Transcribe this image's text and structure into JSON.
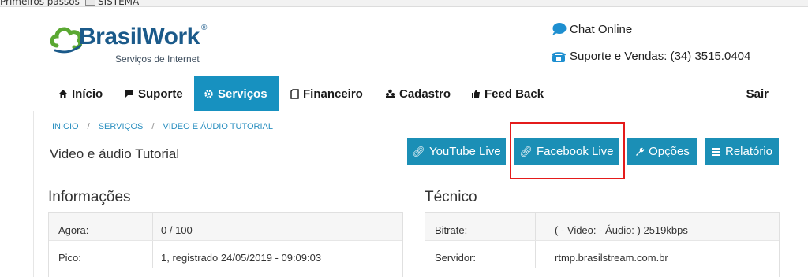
{
  "bookmarks": {
    "items": [
      {
        "label": "Primeiros passos"
      },
      {
        "label": "SISTEMA"
      }
    ]
  },
  "logo": {
    "name": "BrasilWork",
    "registered": "®",
    "tagline": "Serviços de Internet"
  },
  "contact": {
    "chat": "Chat Online",
    "phone": "Suporte e Vendas: (34) 3515.0404"
  },
  "nav": {
    "items": [
      {
        "label": "Início",
        "icon": "home-icon"
      },
      {
        "label": "Suporte",
        "icon": "comment-icon"
      },
      {
        "label": "Serviços",
        "icon": "gear-icon"
      },
      {
        "label": "Financeiro",
        "icon": "document-icon"
      },
      {
        "label": "Cadastro",
        "icon": "users-icon"
      },
      {
        "label": "Feed Back",
        "icon": "thumbs-up-icon"
      }
    ],
    "logout": "Sair"
  },
  "breadcrumb": {
    "items": [
      "INICIO",
      "SERVIÇOS",
      "VIDEO E ÁUDIO TUTORIAL"
    ],
    "separator": "/"
  },
  "page": {
    "title": "Video e áudio Tutorial"
  },
  "actions": {
    "youtube": "YouTube Live",
    "facebook": "Facebook Live",
    "opcoes": "Opções",
    "relatorio": "Relatório"
  },
  "info": {
    "title": "Informações",
    "rows": [
      {
        "key": "Agora:",
        "value": "0 / 100"
      },
      {
        "key": "Pico:",
        "value": "1, registrado 24/05/2019 - 09:09:03"
      }
    ]
  },
  "tecnico": {
    "title": "Técnico",
    "rows": [
      {
        "key": "Bitrate:",
        "value": "( - Video: - Áudio: ) 2519kbps"
      },
      {
        "key": "Servidor:",
        "value": "rtmp.brasilstream.com.br"
      }
    ]
  },
  "colors": {
    "accent": "#1791c0",
    "button": "#1b8fb6",
    "highlight": "#e41b1b",
    "brand": "#1b5a8a"
  }
}
